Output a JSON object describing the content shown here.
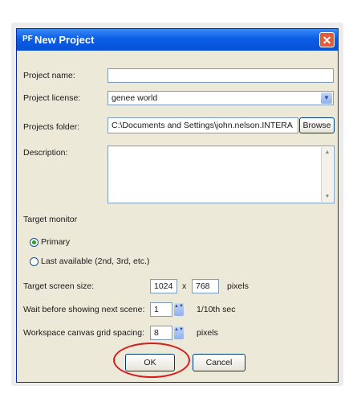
{
  "window": {
    "app_icon": "PF",
    "title": "New Project",
    "close_glyph": "✕"
  },
  "form": {
    "project_name": {
      "label": "Project name:",
      "value": ""
    },
    "project_license": {
      "label": "Project license:",
      "value": "genee world",
      "dropdown_glyph": "▼"
    },
    "projects_folder": {
      "label": "Projects folder:",
      "value": "C:\\Documents and Settings\\john.nelson.INTERA",
      "browse_label": "Browse"
    },
    "description": {
      "label": "Description:",
      "value": "",
      "scroll_up": "▲",
      "scroll_down": "▼"
    },
    "target_monitor": {
      "label": "Target monitor",
      "options": [
        {
          "label": "Primary",
          "selected": true
        },
        {
          "label": "Last available (2nd, 3rd, etc.)",
          "selected": false
        }
      ]
    },
    "target_screen_size": {
      "label": "Target screen size:",
      "width": "1024",
      "separator": "x",
      "height": "768",
      "unit": "pixels"
    },
    "wait_before_next_scene": {
      "label": "Wait before showing next scene:",
      "value": "1",
      "unit": "1/10th sec",
      "spin_glyph": "▲▼"
    },
    "grid_spacing": {
      "label": "Workspace canvas grid spacing:",
      "value": "8",
      "unit": "pixels",
      "spin_glyph": "▲▼"
    }
  },
  "buttons": {
    "ok": "OK",
    "cancel": "Cancel"
  },
  "colors": {
    "title_bar": "#0c5de6",
    "dialog_bg": "#ece9d8",
    "highlight_circle": "#d41c1c",
    "close_button": "#e35b3b"
  }
}
